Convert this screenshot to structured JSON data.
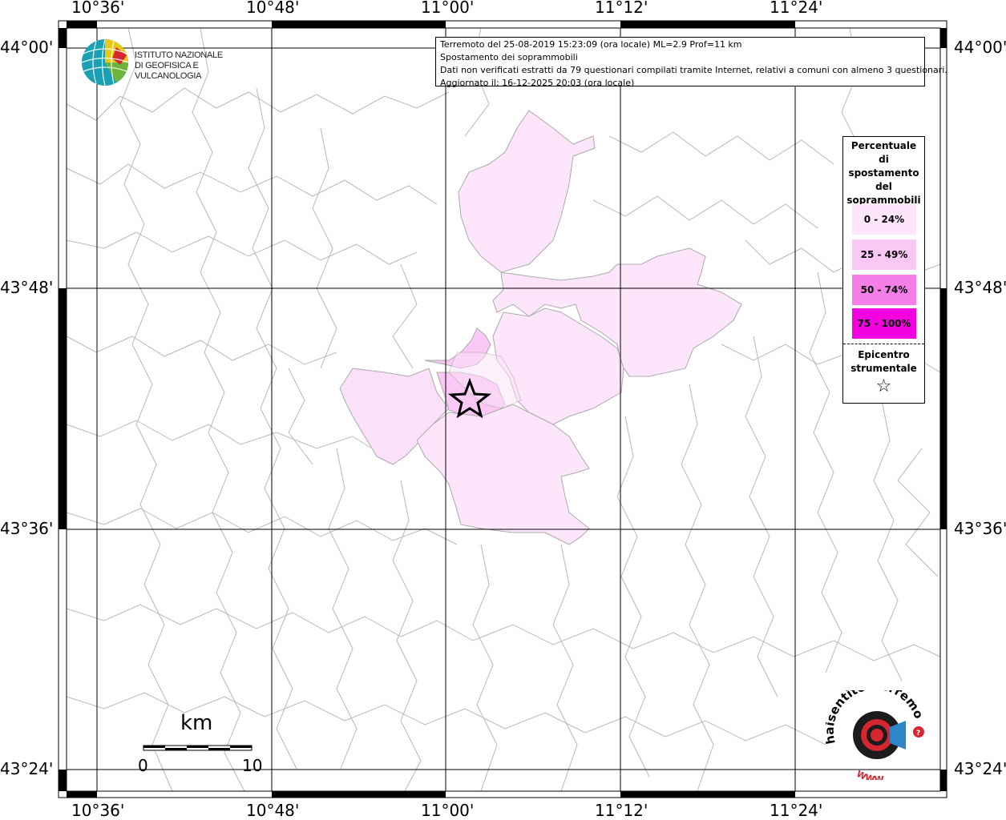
{
  "map": {
    "title_lines": [
      "Terremoto del 25-08-2019 15:23:09 (ora locale) ML=2.9 Prof=11 km",
      "Spostamento dei soprammobili",
      "Dati non verificati estratti da 79 questionari compilati tramite Internet, relativi a comuni con almeno 3 questionari.",
      "Aggiornato il: 16-12-2025 20:03 (ora locale)"
    ],
    "longitude_labels": [
      "10°36'",
      "10°48'",
      "11°00'",
      "11°12'",
      "11°24'"
    ],
    "latitude_labels": [
      "44°00'",
      "43°48'",
      "43°36'",
      "43°24'"
    ]
  },
  "legend": {
    "title_lines": [
      "Percentuale",
      "di",
      "spostamento",
      "del",
      "soprammobili"
    ],
    "classes": [
      {
        "label": "0 - 24%",
        "color": "#fde6fb"
      },
      {
        "label": "25 - 49%",
        "color": "#fbc8f5"
      },
      {
        "label": "50 - 74%",
        "color": "#f57ee8"
      },
      {
        "label": "75 - 100%",
        "color": "#f200e0"
      }
    ],
    "epicenter_lines": [
      "Epicentro",
      "strumentale"
    ],
    "epicenter_symbol": "☆"
  },
  "logos": {
    "ingv_line1": "ISTITUTO NAZIONALE",
    "ingv_line2": "DI GEOFISICA E VULCANOLOGIA",
    "hst_text": "haisentitoilterremoto.it",
    "hst_www": "WWW."
  },
  "scale_bar": {
    "unit": "km",
    "start": "0",
    "end": "10"
  },
  "epicenter": {
    "lat": "43°43'",
    "lon": "11°01'"
  }
}
